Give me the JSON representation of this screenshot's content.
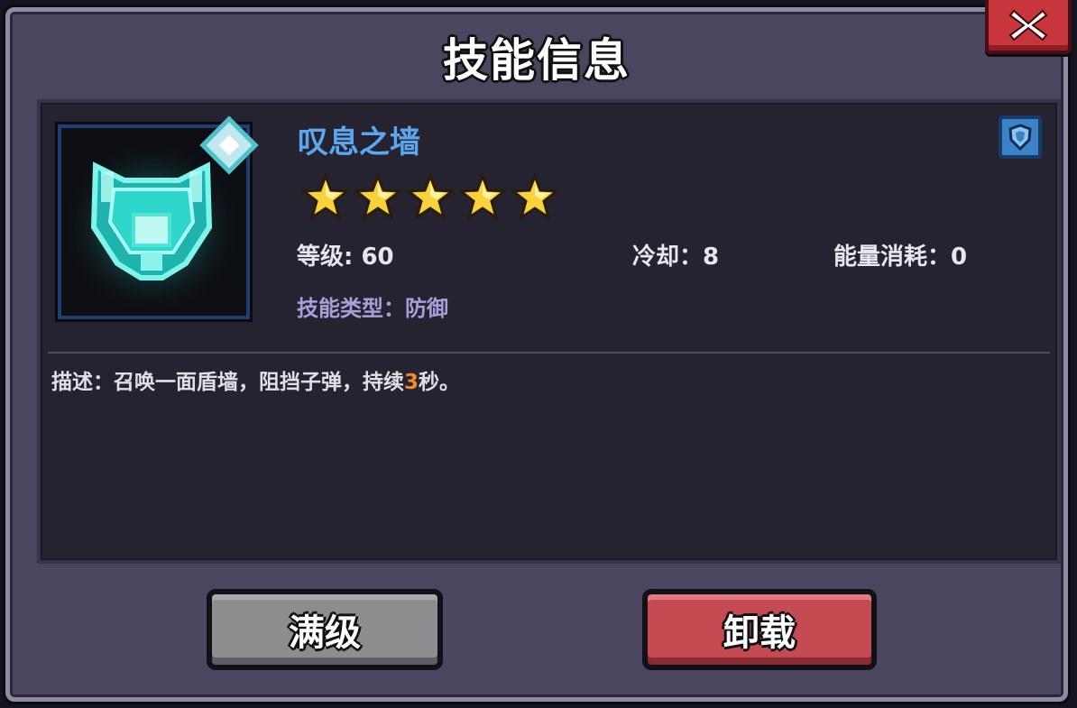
{
  "dialog": {
    "title": "技能信息",
    "close_icon": "close-x-icon"
  },
  "skill": {
    "name": "叹息之墙",
    "icon": "energy-shield-icon",
    "badge_icon": "shield-badge-icon",
    "stars": 5,
    "stars_max": 5,
    "level_label": "等级: 60",
    "cooldown_label": "冷却：8",
    "energy_label": "能量消耗：0",
    "type_label": "技能类型：防御",
    "description": {
      "before": "描述：召唤一面盾墙，阻挡子弹，持续",
      "highlight": "3",
      "after": "秒。"
    }
  },
  "buttons": {
    "max_level": "满级",
    "unload": "卸载"
  },
  "colors": {
    "accent_name": "#5aa7ee",
    "highlight": "#f28a2a",
    "button_unload": "#c44b52",
    "button_max": "#8d8d8f"
  }
}
